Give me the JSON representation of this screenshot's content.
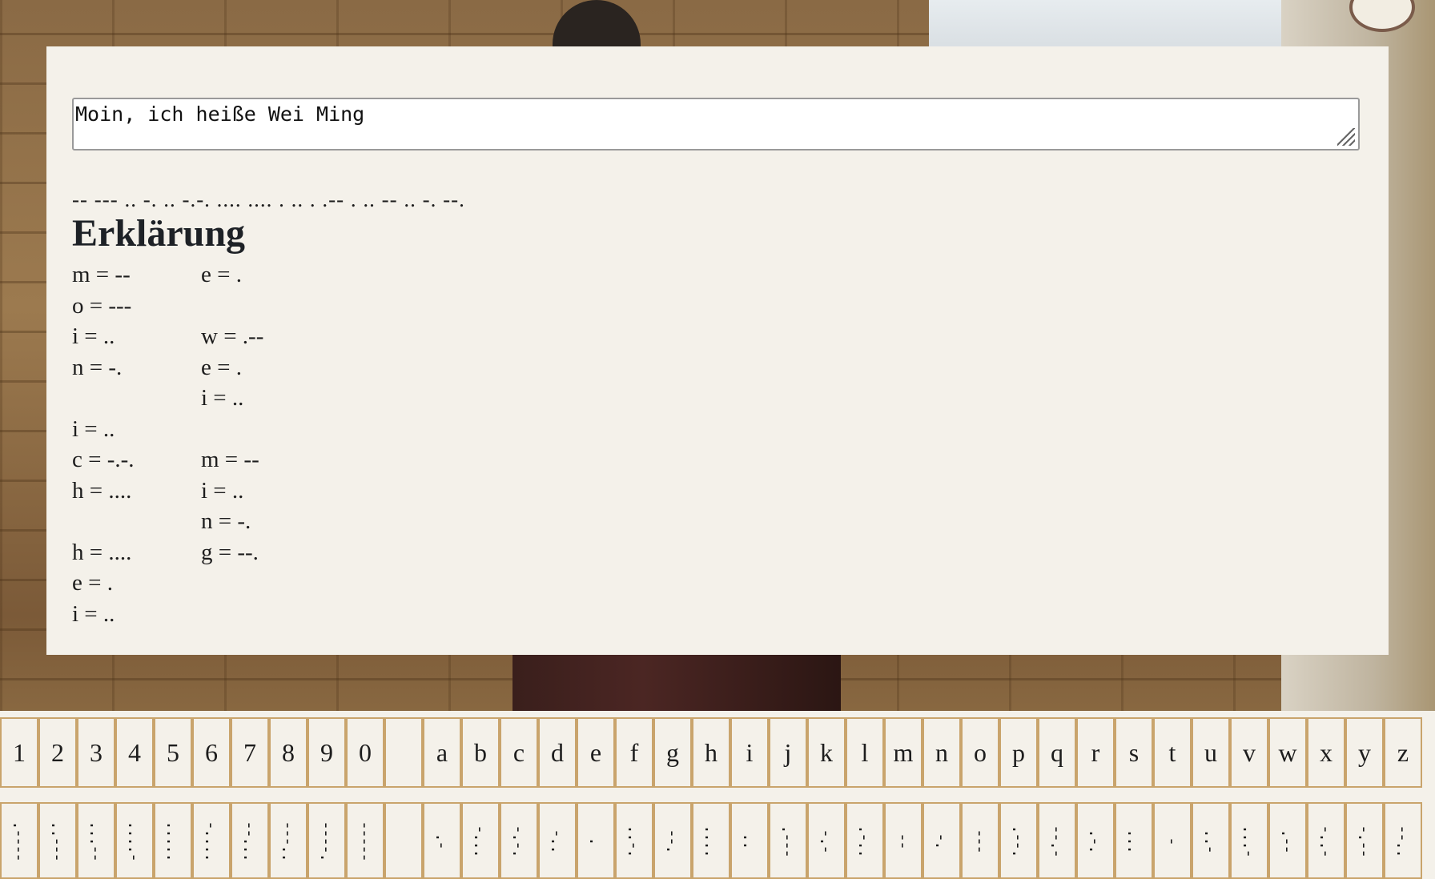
{
  "input": {
    "value": "Moin, ich heiße Wei Ming"
  },
  "output": {
    "morse": "-- --- .. -. .. -.-. .... .... . .. . .-- . .. -- .. -. --."
  },
  "explanation": {
    "heading": "Erklärung",
    "rows": [
      {
        "c1": "m = --",
        "c2": "e = ."
      },
      {
        "c1": "o = ---",
        "c2": ""
      },
      {
        "c1": "i = ..",
        "c2": "w = .--"
      },
      {
        "c1": "n = -.",
        "c2": "e = ."
      },
      {
        "c1": "",
        "c2": "i = .."
      },
      {
        "c1": "i = ..",
        "c2": ""
      },
      {
        "c1": "c = -.-.",
        "c2": "m = --"
      },
      {
        "c1": "h = ....",
        "c2": "i = .."
      },
      {
        "c1": "",
        "c2": "n = -."
      },
      {
        "c1": "h = ....",
        "c2": "g = --."
      },
      {
        "c1": "e = .",
        "c2": ""
      },
      {
        "c1": "i = ..",
        "c2": ""
      }
    ]
  },
  "keyboard": {
    "keys": [
      "1",
      "2",
      "3",
      "4",
      "5",
      "6",
      "7",
      "8",
      "9",
      "0",
      "",
      "a",
      "b",
      "c",
      "d",
      "e",
      "f",
      "g",
      "h",
      "i",
      "j",
      "k",
      "l",
      "m",
      "n",
      "o",
      "p",
      "q",
      "r",
      "s",
      "t",
      "u",
      "v",
      "w",
      "x",
      "y",
      "z"
    ],
    "morse": [
      ".----",
      "..---",
      "...--",
      "....-",
      ".....",
      "-....",
      "--...",
      "---..",
      "----.",
      "-----",
      "",
      ".-",
      "-...",
      "-.-.",
      "-..",
      ".",
      "..-.",
      "--.",
      "....",
      "..",
      ".---",
      "-.-",
      ".-..",
      "--",
      "-.",
      "---",
      ".--.",
      "--.-",
      ".-.",
      "...",
      "-",
      "..-",
      "...-",
      ".--",
      "-..-",
      "-.--",
      "--.."
    ]
  }
}
